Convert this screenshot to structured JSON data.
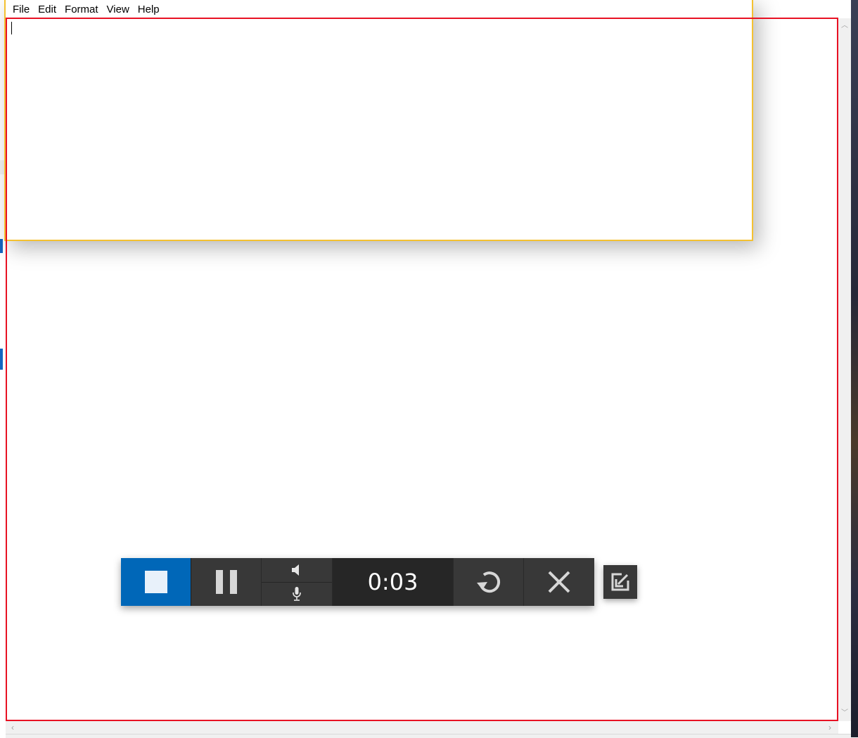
{
  "notepad": {
    "menu": [
      "File",
      "Edit",
      "Format",
      "View",
      "Help"
    ],
    "content": ""
  },
  "recorder": {
    "timer": "0:03",
    "stop_accent": "#0067b8",
    "buttons": {
      "stop": "stop-icon",
      "pause": "pause-icon",
      "speaker": "speaker-icon",
      "microphone": "microphone-icon",
      "restart": "restart-icon",
      "close": "close-icon",
      "popout": "popout-icon"
    }
  },
  "capture_region": {
    "border_color": "#e81123"
  }
}
